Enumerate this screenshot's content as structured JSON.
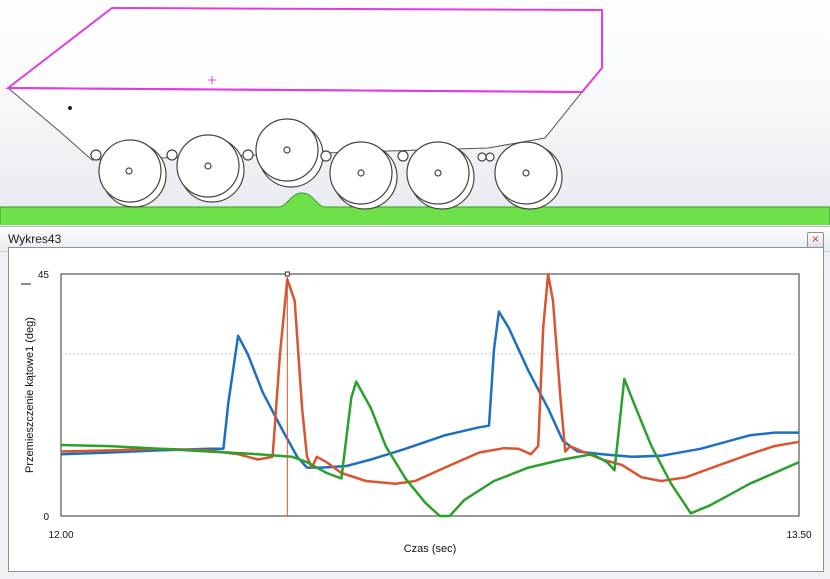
{
  "window": {
    "title": "Wykres43",
    "close_glyph": "×"
  },
  "viewport": {
    "hull_outline_color": "#e23be0",
    "ground_color": "#6ee04a"
  },
  "chart_data": {
    "type": "line",
    "title": "",
    "xlabel": "Czas (sec)",
    "ylabel": "Przemieszczenie kątowe1 (deg)",
    "xlim": [
      12.0,
      13.5
    ],
    "ylim": [
      0,
      45
    ],
    "x_tick_labels": [
      "12.00",
      "13.50"
    ],
    "y_tick_labels": [
      "0",
      "45"
    ],
    "cursor_x": 12.46,
    "series": [
      {
        "color": "#1f6fbf",
        "points": [
          [
            12.0,
            11.5
          ],
          [
            12.1,
            11.8
          ],
          [
            12.2,
            12.2
          ],
          [
            12.3,
            12.5
          ],
          [
            12.33,
            12.5
          ],
          [
            12.34,
            21
          ],
          [
            12.36,
            33.5
          ],
          [
            12.38,
            30
          ],
          [
            12.41,
            23
          ],
          [
            12.45,
            16
          ],
          [
            12.48,
            11
          ],
          [
            12.5,
            9
          ],
          [
            12.53,
            9
          ],
          [
            12.58,
            9.3
          ],
          [
            12.63,
            10.5
          ],
          [
            12.7,
            12.5
          ],
          [
            12.78,
            15
          ],
          [
            12.85,
            16.5
          ],
          [
            12.87,
            16.8
          ],
          [
            12.88,
            31
          ],
          [
            12.89,
            38
          ],
          [
            12.91,
            35
          ],
          [
            12.95,
            27
          ],
          [
            12.99,
            20
          ],
          [
            13.02,
            14
          ],
          [
            13.05,
            12
          ],
          [
            13.1,
            11.5
          ],
          [
            13.16,
            11
          ],
          [
            13.22,
            11.2
          ],
          [
            13.3,
            12.5
          ],
          [
            13.4,
            15
          ],
          [
            13.45,
            15.5
          ],
          [
            13.5,
            15.5
          ]
        ]
      },
      {
        "color": "#d9542f",
        "points": [
          [
            12.0,
            12
          ],
          [
            12.1,
            12.2
          ],
          [
            12.2,
            12.5
          ],
          [
            12.3,
            12.2
          ],
          [
            12.36,
            11.5
          ],
          [
            12.4,
            10.5
          ],
          [
            12.43,
            11
          ],
          [
            12.445,
            30
          ],
          [
            12.46,
            44
          ],
          [
            12.475,
            40
          ],
          [
            12.49,
            20
          ],
          [
            12.5,
            11
          ],
          [
            12.51,
            9
          ],
          [
            12.52,
            11
          ],
          [
            12.54,
            10
          ],
          [
            12.57,
            8
          ],
          [
            12.62,
            6.5
          ],
          [
            12.68,
            6
          ],
          [
            12.72,
            6.5
          ],
          [
            12.78,
            9
          ],
          [
            12.85,
            11.8
          ],
          [
            12.9,
            12.6
          ],
          [
            12.93,
            12.5
          ],
          [
            12.955,
            11.5
          ],
          [
            12.97,
            13
          ],
          [
            12.98,
            35
          ],
          [
            12.99,
            45
          ],
          [
            13.0,
            40
          ],
          [
            13.015,
            22
          ],
          [
            13.025,
            12
          ],
          [
            13.035,
            13
          ],
          [
            13.06,
            12
          ],
          [
            13.1,
            10.5
          ],
          [
            13.14,
            9.5
          ],
          [
            13.18,
            7.2
          ],
          [
            13.22,
            6.5
          ],
          [
            13.27,
            7.2
          ],
          [
            13.33,
            9.2
          ],
          [
            13.4,
            11.5
          ],
          [
            13.45,
            13
          ],
          [
            13.5,
            13.8
          ]
        ]
      },
      {
        "color": "#2ca02c",
        "points": [
          [
            12.0,
            13.2
          ],
          [
            12.1,
            13
          ],
          [
            12.2,
            12.5
          ],
          [
            12.3,
            12
          ],
          [
            12.4,
            11.5
          ],
          [
            12.47,
            11
          ],
          [
            12.5,
            10
          ],
          [
            12.54,
            8
          ],
          [
            12.57,
            7
          ],
          [
            12.59,
            22
          ],
          [
            12.6,
            25
          ],
          [
            12.63,
            20
          ],
          [
            12.66,
            13
          ],
          [
            12.7,
            7
          ],
          [
            12.74,
            2.5
          ],
          [
            12.77,
            0
          ],
          [
            12.79,
            0
          ],
          [
            12.82,
            3
          ],
          [
            12.88,
            6.5
          ],
          [
            12.95,
            9
          ],
          [
            13.02,
            10.5
          ],
          [
            13.08,
            11.5
          ],
          [
            13.11,
            10
          ],
          [
            13.125,
            8.5
          ],
          [
            13.145,
            25.5
          ],
          [
            13.16,
            22
          ],
          [
            13.2,
            13
          ],
          [
            13.24,
            6
          ],
          [
            13.28,
            0.5
          ],
          [
            13.32,
            2
          ],
          [
            13.4,
            6
          ],
          [
            13.45,
            8
          ],
          [
            13.5,
            10
          ]
        ]
      }
    ]
  }
}
